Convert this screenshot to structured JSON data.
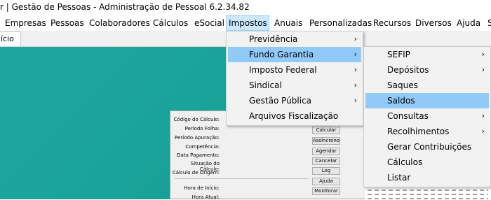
{
  "window": {
    "title": "r | Gestão de Pessoas - Administração de Pessoal 6.2.34.82"
  },
  "menubar": {
    "items": [
      "Empresas",
      "Pessoas",
      "Colaboradores",
      "Cálculos",
      "eSocial",
      "Impostos",
      "Anuais",
      "Personalizadas",
      "Recursos",
      "Diversos",
      "Ajuda",
      "Sem"
    ]
  },
  "tabs": {
    "home": "ício"
  },
  "impostos_menu": {
    "items": [
      "Previdência",
      "Fundo Garantia",
      "Imposto Federal",
      "Sindical",
      "Gestão Pública",
      "Arquivos Fiscalização"
    ]
  },
  "fundo_submenu": {
    "items": [
      "SEFIP",
      "Depósitos",
      "Saques",
      "Saldos",
      "Consultas",
      "Recolhimentos",
      "Gerar Contribuições",
      "Cálculos",
      "Listar"
    ]
  },
  "panel": {
    "labels": [
      "Código do Cálculo:",
      "Período Folha:",
      "Período Apuração:",
      "Competência:",
      "Data Pagamento:",
      "Situação do Cálculo:",
      "Cálculo de Origem:",
      "Hora de Início:",
      "Hora Atual:"
    ],
    "buttons": [
      "Calcular",
      "Assíncrono",
      "Agendar",
      "Cancelar",
      "Log",
      "Ajuda",
      "Monitorar"
    ]
  },
  "colors": {
    "desktop": "#1aa39a",
    "highlight": "#91c9f7",
    "menubar_active": "#cce8ff"
  },
  "icons": {
    "submenu_arrow": "chevron-right-icon"
  }
}
